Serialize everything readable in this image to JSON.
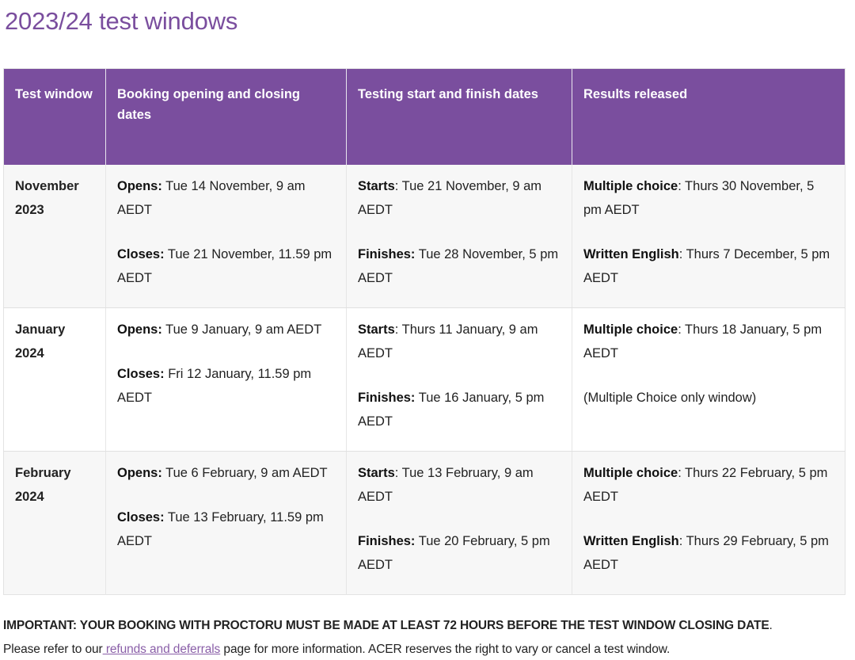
{
  "page": {
    "title": "2023/24 test windows",
    "accent_color": "#7a4e9e",
    "header_bg": "#7a4e9e",
    "header_text_color": "#ffffff",
    "stripe_color": "#f7f7f7",
    "link_color": "#8a5fa8"
  },
  "table": {
    "name": "test-windows-table",
    "headers": [
      "Test window",
      "Booking opening and closing dates",
      " Testing start and finish dates",
      "Results released"
    ],
    "rows": [
      {
        "window": "November 2023",
        "booking": [
          {
            "label": "Opens:",
            "value": " Tue 14 November, 9 am AEDT"
          },
          {
            "label": "Closes:",
            "value": " Tue 21 November, 11.59 pm AEDT"
          }
        ],
        "testing": [
          {
            "label": "Starts",
            "value": ": Tue 21 November, 9 am AEDT"
          },
          {
            "label": "Finishes:",
            "value": " Tue 28 November, 5 pm AEDT"
          }
        ],
        "results": [
          {
            "label": "Multiple choice",
            "value": ": Thurs 30 November, 5 pm AEDT"
          },
          {
            "label": "Written English",
            "value": ": Thurs 7 December, 5 pm AEDT"
          }
        ]
      },
      {
        "window": "January 2024",
        "booking": [
          {
            "label": "Opens:",
            "value": " Tue 9 January, 9 am AEDT"
          },
          {
            "label": "Closes:",
            "value": " Fri 12 January, 11.59 pm AEDT"
          }
        ],
        "testing": [
          {
            "label": "Starts",
            "value": ": Thurs 11 January, 9 am AEDT"
          },
          {
            "label": "Finishes:",
            "value": " Tue 16 January, 5 pm AEDT"
          }
        ],
        "results": [
          {
            "label": "Multiple choice",
            "value": ": Thurs 18 January, 5 pm AEDT"
          },
          {
            "label": "",
            "value": "(Multiple Choice only window)"
          }
        ]
      },
      {
        "window": "February 2024",
        "booking": [
          {
            "label": "Opens:",
            "value": " Tue 6 February, 9 am AEDT"
          },
          {
            "label": "Closes:",
            "value": " Tue 13 February, 11.59 pm AEDT"
          }
        ],
        "testing": [
          {
            "label": "Starts",
            "value": ": Tue 13 February, 9 am AEDT"
          },
          {
            "label": "Finishes:",
            "value": " Tue 20 February, 5 pm AEDT"
          }
        ],
        "results": [
          {
            "label": "Multiple choice",
            "value": ": Thurs 22 February, 5 pm AEDT"
          },
          {
            "label": "Written English",
            "value": ": Thurs 29 February, 5 pm AEDT"
          }
        ]
      }
    ]
  },
  "footer": {
    "important_text": "IMPORTANT: YOUR BOOKING WITH PROCTORU MUST BE MADE AT LEAST 72 HOURS BEFORE THE TEST WINDOW CLOSING DATE",
    "important_tail": ".",
    "note_prefix": "Please refer to our",
    "note_link": " refunds and deferrals",
    "note_suffix": " page for more information. ACER reserves the right to vary or cancel a test window."
  }
}
